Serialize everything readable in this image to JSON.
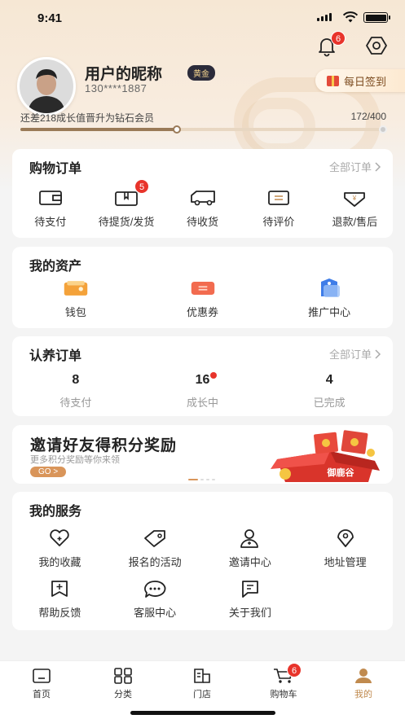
{
  "status_bar": {
    "time": "9:41"
  },
  "header": {
    "notification_count": "6",
    "nickname": "用户的昵称",
    "level_badge": "黄金",
    "phone": "130****1887",
    "checkin_label": "每日签到",
    "growth_text": "还差218成长值晋升为钻石会员",
    "growth_value": "172/400",
    "growth_progress": 0.43
  },
  "orders": {
    "title": "购物订单",
    "more": "全部订单",
    "items": [
      {
        "label": "待支付",
        "icon": "wallet-icon"
      },
      {
        "label": "待提货/发货",
        "icon": "pickup-icon",
        "badge": "5"
      },
      {
        "label": "待收货",
        "icon": "truck-icon"
      },
      {
        "label": "待评价",
        "icon": "comment-icon"
      },
      {
        "label": "退款/售后",
        "icon": "refund-icon"
      }
    ]
  },
  "assets": {
    "title": "我的资产",
    "items": [
      {
        "label": "钱包",
        "icon": "wallet-color-icon"
      },
      {
        "label": "优惠券",
        "icon": "coupon-icon"
      },
      {
        "label": "推广中心",
        "icon": "promotion-icon"
      }
    ]
  },
  "adoption": {
    "title": "认养订单",
    "more": "全部订单",
    "items": [
      {
        "value": "8",
        "label": "待支付"
      },
      {
        "value": "16",
        "label": "成长中"
      },
      {
        "value": "4",
        "label": "已完成"
      }
    ]
  },
  "banner": {
    "title": "邀请好友得积分奖励",
    "subtitle": "更多积分奖励等你来领",
    "button": "GO >",
    "box_text": "御鹿谷"
  },
  "services": {
    "title": "我的服务",
    "items": [
      {
        "label": "我的收藏",
        "icon": "favorite-icon"
      },
      {
        "label": "报名的活动",
        "icon": "tag-icon"
      },
      {
        "label": "邀请中心",
        "icon": "invite-user-icon"
      },
      {
        "label": "地址管理",
        "icon": "location-icon"
      },
      {
        "label": "帮助反馈",
        "icon": "feedback-icon"
      },
      {
        "label": "客服中心",
        "icon": "customer-service-icon"
      },
      {
        "label": "关于我们",
        "icon": "about-icon"
      }
    ]
  },
  "tabbar": {
    "items": [
      {
        "label": "首页",
        "icon": "home-icon"
      },
      {
        "label": "分类",
        "icon": "category-icon"
      },
      {
        "label": "门店",
        "icon": "store-icon"
      },
      {
        "label": "购物车",
        "icon": "cart-icon",
        "badge": "6"
      },
      {
        "label": "我的",
        "icon": "profile-icon",
        "active": true
      }
    ]
  },
  "colors": {
    "accent": "#c08a4e",
    "badge": "#e8342b",
    "hero_bg": "#f6e7d4"
  }
}
